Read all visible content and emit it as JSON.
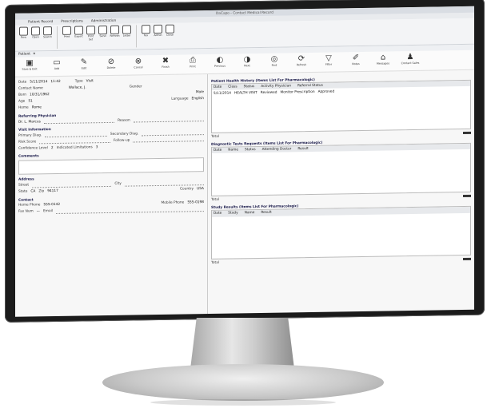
{
  "window": {
    "title": "DaCapo - Contact Medical Record"
  },
  "ribbon_tabs": [
    "Patient Record",
    "Prescriptions",
    "Administration"
  ],
  "ribbon_buttons": [
    "New",
    "Open",
    "Search",
    "Print",
    "Export",
    "Print Set",
    "Send",
    "Refresh",
    "Letter",
    "Fax",
    "Admin",
    "Close"
  ],
  "ribbon_groups": [
    "Patient",
    "Actions",
    "Window"
  ],
  "winbar": {
    "label": "Patient"
  },
  "toolbar": [
    "Save & Exit",
    "Add",
    "Edit",
    "Delete",
    "Cancel",
    "Finish",
    "Print",
    "Previous",
    "Next",
    "Find",
    "Refresh",
    "Filter",
    "Notes",
    "Messages",
    "Contact Sales"
  ],
  "left": {
    "date_label": "Date",
    "date_value": "5/11/2014",
    "time_value": "11:42",
    "type_label": "Type",
    "type_value": "Visit",
    "contact_label": "Contact Name",
    "contact_value": "Wallace, J.",
    "gender_label": "Gender",
    "gender_value": "Male",
    "born_label": "Born",
    "born_value": "10/31/1962",
    "age_label": "Age",
    "age_value": "51",
    "home_label": "Home",
    "home_value": "Rome",
    "lang_label": "Language",
    "lang_value": "English",
    "referring_section": "Referring Physician",
    "referring_value": "Dr. L. Marcus",
    "reason_label": "Reason",
    "reason_value": "",
    "visit_section": "Visit Information",
    "primary_label": "Primary Diag.",
    "secondary_label": "Secondary Diag.",
    "risk_label": "Risk Score",
    "risk_value": "",
    "followup_label": "Follow-up",
    "conf_label": "Confidence Level",
    "conf_value": "2",
    "severity_label": "Indicated Limitations",
    "severity_value": "3",
    "comments_section": "Comments",
    "address_section": "Address",
    "street_label": "Street",
    "city_label": "City",
    "state_label": "State",
    "state_value": "CA",
    "zip_label": "Zip",
    "zip_value": "94117",
    "country_label": "Country",
    "country_value": "USA",
    "contact_section": "Contact",
    "phone_label": "Home Phone",
    "phone_value": "555-0142",
    "mobile_label": "Mobile Phone",
    "mobile_value": "555-0198",
    "email_label": "Email",
    "email_value": "",
    "fax_label": "Fax Num",
    "fax_value": "—"
  },
  "right": {
    "panel1": {
      "title": "Patient Health History (Items List For Pharmacologic)",
      "headers": [
        "Date",
        "Class",
        "Status",
        "Activity Physician",
        "Referral Status"
      ],
      "row": [
        "5/11/2014",
        "HEALTH VISIT",
        "Reviewed",
        "Monitor Prescription",
        "Approved"
      ],
      "footer": "Total"
    },
    "panel2": {
      "title": "Diagnostic Tests Requests (Items List For Pharmacologic)",
      "headers": [
        "Date",
        "Name",
        "Status",
        "Attending Doctor",
        "Result"
      ],
      "footer": "Total"
    },
    "panel3": {
      "title": "Study Results (Items List For Pharmacologic)",
      "headers": [
        "Date",
        "Study",
        "Name",
        "Result"
      ],
      "footer": "Total"
    }
  }
}
